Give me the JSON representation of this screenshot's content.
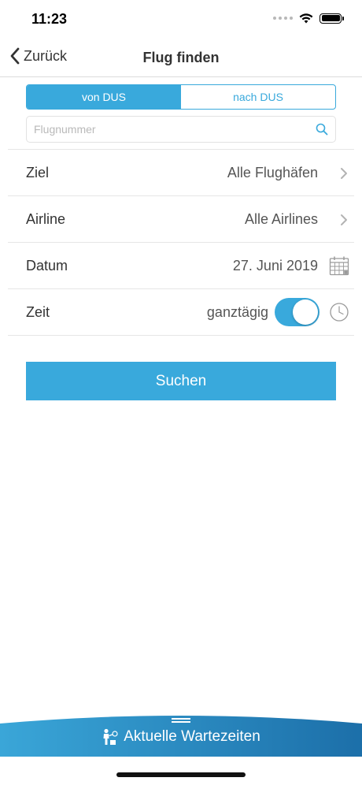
{
  "status_bar": {
    "time": "11:23"
  },
  "nav": {
    "back_label": "Zurück",
    "title": "Flug finden"
  },
  "segment": {
    "items": [
      {
        "label": "von DUS",
        "active": true
      },
      {
        "label": "nach DUS",
        "active": false
      }
    ]
  },
  "search": {
    "placeholder": "Flugnummer",
    "value": ""
  },
  "rows": {
    "ziel": {
      "label": "Ziel",
      "value": "Alle Flughäfen"
    },
    "airline": {
      "label": "Airline",
      "value": "Alle Airlines"
    },
    "datum": {
      "label": "Datum",
      "value": "27. Juni 2019"
    },
    "zeit": {
      "label": "Zeit",
      "value": "ganztägig",
      "toggle_on": true
    }
  },
  "search_button": {
    "label": "Suchen"
  },
  "drawer": {
    "label": "Aktuelle Wartezeiten"
  },
  "colors": {
    "accent": "#39a9dc",
    "drawer_start": "#3aa6d8",
    "drawer_end": "#1c6fa9"
  },
  "icons": [
    "chevron-left-icon",
    "wifi-icon",
    "battery-icon",
    "search-icon",
    "chevron-right-icon",
    "calendar-icon",
    "clock-icon",
    "waiting-person-icon"
  ]
}
